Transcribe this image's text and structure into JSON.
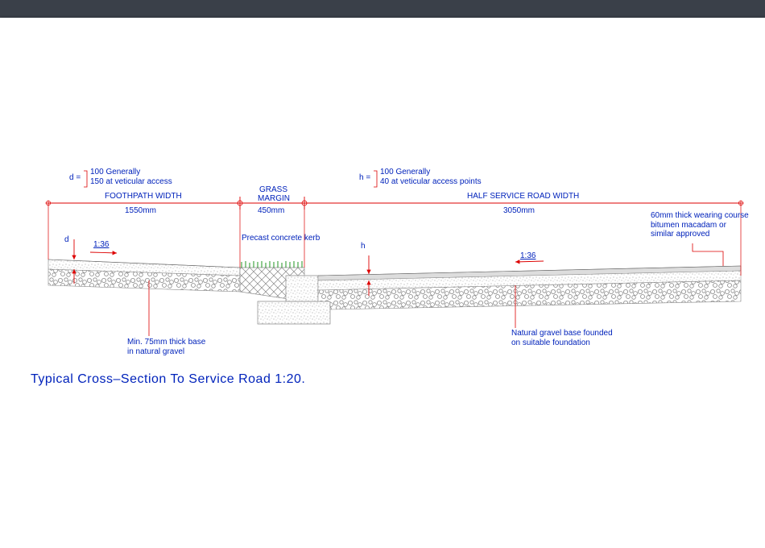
{
  "title": "Typical Cross–Section To Service Road 1:20.",
  "d_var": "d =",
  "d_line1": "100 Generally",
  "d_line2": "150 at veticular access",
  "h_var": "h =",
  "h_line1": "100 Generally",
  "h_line2": "40 at veticular access points",
  "footpath_label": "FOOTHPATH WIDTH",
  "footpath_value": "1550mm",
  "grass_label1": "GRASS",
  "grass_label2": "MARGIN",
  "grass_value": "450mm",
  "half_road_label": "HALF SERVICE ROAD WIDTH",
  "half_road_value": "3050mm",
  "d_dim": "d",
  "h_dim": "h",
  "slope1": "1:36",
  "slope2": "1:36",
  "kerb_note": "Precast concrete kerb",
  "base_note": "Min. 75mm thick base\nin natural gravel",
  "gravel_note": "Natural gravel base founded\non suitable foundation",
  "wearing_note": "60mm thick wearing course\nbitumen macadam or\nsimilar approved"
}
